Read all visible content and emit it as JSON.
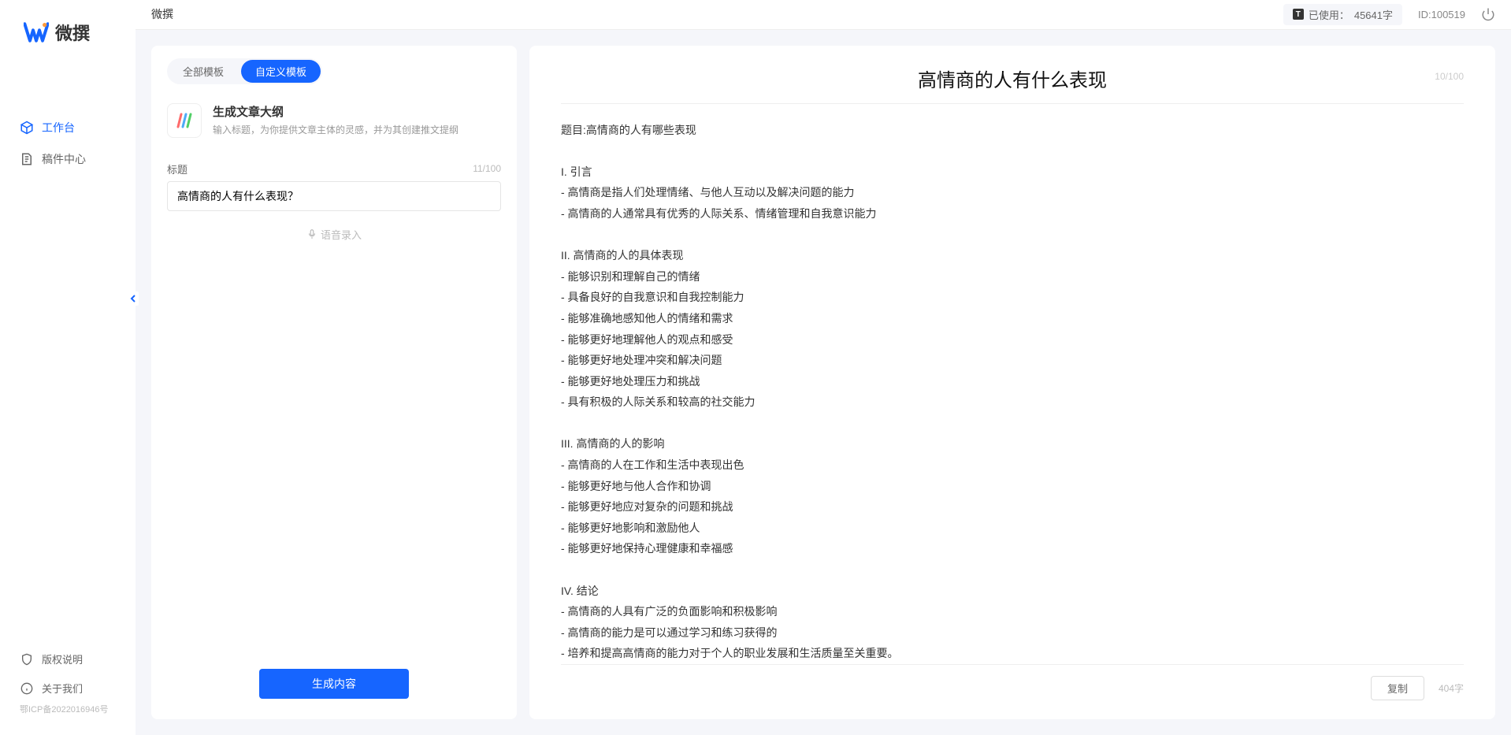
{
  "app": {
    "name": "微撰"
  },
  "sidebar": {
    "nav": [
      {
        "label": "工作台",
        "icon": "cube"
      },
      {
        "label": "稿件中心",
        "icon": "doc"
      }
    ],
    "bottom": [
      {
        "label": "版权说明",
        "icon": "shield"
      },
      {
        "label": "关于我们",
        "icon": "info"
      }
    ],
    "icp": "鄂ICP备2022016946号"
  },
  "topbar": {
    "breadcrumb": "微撰",
    "usage_label": "已使用：",
    "usage_value": "45641字",
    "user_id": "ID:100519"
  },
  "left": {
    "tabs": [
      {
        "label": "全部模板"
      },
      {
        "label": "自定义模板"
      }
    ],
    "template": {
      "title": "生成文章大纲",
      "desc": "输入标题，为你提供文章主体的灵感，并为其创建推文提纲"
    },
    "form": {
      "title_label": "标题",
      "title_count": "11/100",
      "title_value": "高情商的人有什么表现？",
      "voice_label": "语音录入"
    },
    "generate_btn": "生成内容"
  },
  "right": {
    "title": "高情商的人有什么表现",
    "counter": "10/100",
    "body": "题目:高情商的人有哪些表现\n\nI. 引言\n- 高情商是指人们处理情绪、与他人互动以及解决问题的能力\n- 高情商的人通常具有优秀的人际关系、情绪管理和自我意识能力\n\nII. 高情商的人的具体表现\n- 能够识别和理解自己的情绪\n- 具备良好的自我意识和自我控制能力\n- 能够准确地感知他人的情绪和需求\n- 能够更好地理解他人的观点和感受\n- 能够更好地处理冲突和解决问题\n- 能够更好地处理压力和挑战\n- 具有积极的人际关系和较高的社交能力\n\nIII. 高情商的人的影响\n- 高情商的人在工作和生活中表现出色\n- 能够更好地与他人合作和协调\n- 能够更好地应对复杂的问题和挑战\n- 能够更好地影响和激励他人\n- 能够更好地保持心理健康和幸福感\n\nIV. 结论\n- 高情商的人具有广泛的负面影响和积极影响\n- 高情商的能力是可以通过学习和练习获得的\n- 培养和提高高情商的能力对于个人的职业发展和生活质量至关重要。",
    "copy_btn": "复制",
    "word_count": "404字"
  }
}
